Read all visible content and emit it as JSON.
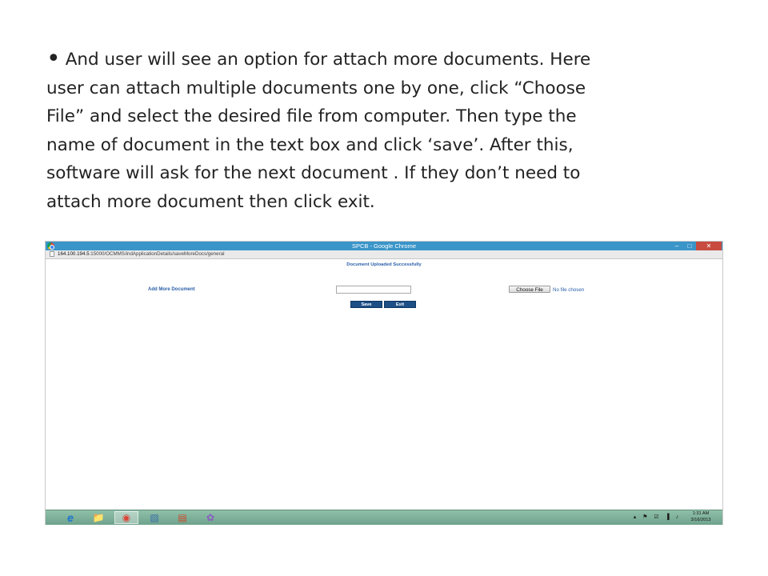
{
  "slide": {
    "bullet": "•",
    "lines": [
      "And user will see an option for attach more documents. Here",
      "user can attach multiple documents one by one, click “Choose",
      "File” and select the desired file from computer. Then type the",
      "name of document in the text box and click ‘save’. After this,",
      "software will ask for the next document . If they don’t need to",
      "attach more document then click exit."
    ]
  },
  "browser": {
    "window_title": "SPCB - Google Chrome",
    "url_host": "164.100.194.5",
    "url_path": ":15000/OCMMS/indApplicationDetails/saveMoreDocs/general",
    "minimize_glyph": "–",
    "maximize_glyph": "□",
    "close_glyph": "✕"
  },
  "page": {
    "status_message": "Document Uploaded Successfully",
    "add_more_label": "Add More Document",
    "document_name_value": "",
    "choose_file_label": "Choose File",
    "no_file_text": "No file chosen",
    "save_label": "Save",
    "exit_label": "Exit"
  },
  "taskbar": {
    "items": [
      {
        "name": "internet-explorer",
        "glyph": "e",
        "color": "#1e73d2"
      },
      {
        "name": "file-explorer",
        "glyph": "📁",
        "color": "#e6b84a"
      },
      {
        "name": "google-chrome",
        "glyph": "◉",
        "color": "#db4437"
      },
      {
        "name": "app-window",
        "glyph": "▧",
        "color": "#3b6fa8"
      },
      {
        "name": "powerpoint",
        "glyph": "▤",
        "color": "#c94b2b"
      },
      {
        "name": "paint",
        "glyph": "✿",
        "color": "#8a5cc0"
      }
    ],
    "tray_icons": "▴ ⚑ ☑ ▐ ♪",
    "time": "1:31 AM",
    "date": "3/16/2013"
  }
}
